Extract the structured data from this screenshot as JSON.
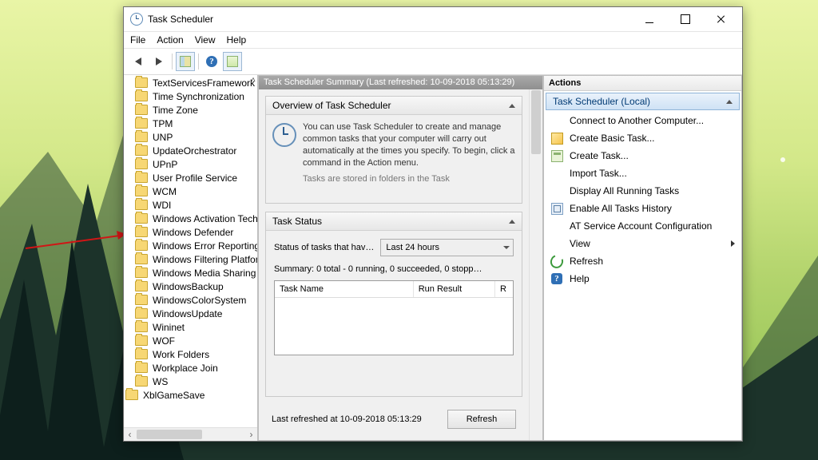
{
  "window": {
    "title": "Task Scheduler",
    "menu": {
      "file": "File",
      "action": "Action",
      "view": "View",
      "help": "Help"
    }
  },
  "tree": {
    "items": [
      "TextServicesFramework",
      "Time Synchronization",
      "Time Zone",
      "TPM",
      "UNP",
      "UpdateOrchestrator",
      "UPnP",
      "User Profile Service",
      "WCM",
      "WDI",
      "Windows Activation Technologies",
      "Windows Defender",
      "Windows Error Reporting",
      "Windows Filtering Platform",
      "Windows Media Sharing",
      "WindowsBackup",
      "WindowsColorSystem",
      "WindowsUpdate",
      "Wininet",
      "WOF",
      "Work Folders",
      "Workplace Join",
      "WS"
    ],
    "top_level": "XblGameSave"
  },
  "summary": {
    "header": "Task Scheduler Summary (Last refreshed: 10-09-2018 05:13:29)",
    "overview_title": "Overview of Task Scheduler",
    "overview_text": "You can use Task Scheduler to create and manage common tasks that your computer will carry out automatically at the times you specify. To begin, click a command in the Action menu.",
    "overview_fade": "Tasks are stored in folders in the Task",
    "task_status_title": "Task Status",
    "status_label": "Status of tasks that hav…",
    "status_value": "Last 24 hours",
    "status_summary": "Summary: 0 total - 0 running, 0 succeeded, 0 stopp…",
    "grid": {
      "col1": "Task Name",
      "col2": "Run Result",
      "col3": "R"
    },
    "last_refreshed": "Last refreshed at 10-09-2018 05:13:29",
    "refresh_btn": "Refresh"
  },
  "actions": {
    "title": "Actions",
    "scope": "Task Scheduler (Local)",
    "items": [
      {
        "icon": "none",
        "label": "Connect to Another Computer..."
      },
      {
        "icon": "wiz",
        "label": "Create Basic Task..."
      },
      {
        "icon": "task",
        "label": "Create Task..."
      },
      {
        "icon": "none",
        "label": "Import Task..."
      },
      {
        "icon": "none",
        "label": "Display All Running Tasks"
      },
      {
        "icon": "enable",
        "label": "Enable All Tasks History"
      },
      {
        "icon": "none",
        "label": "AT Service Account Configuration"
      },
      {
        "icon": "none",
        "label": "View",
        "submenu": true
      },
      {
        "icon": "refresh",
        "label": "Refresh"
      },
      {
        "icon": "help",
        "label": "Help"
      }
    ]
  }
}
